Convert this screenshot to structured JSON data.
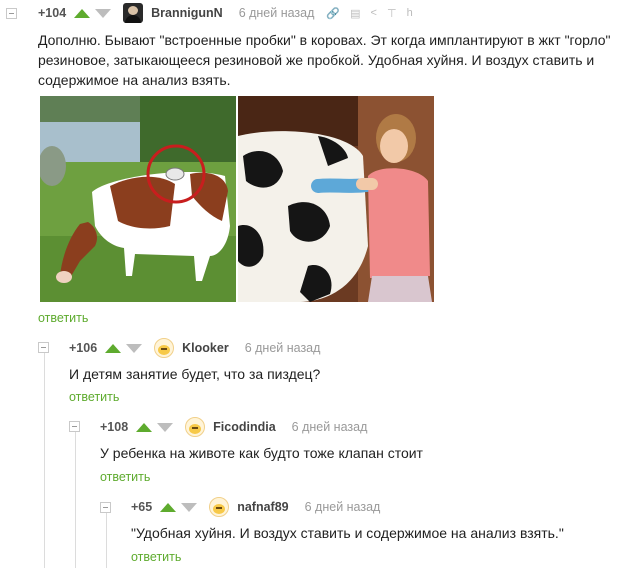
{
  "comments": [
    {
      "rating": "+104",
      "username": "BrannigunN",
      "time": "6 дней назад",
      "text_lines": [
        "Дополню. Бывают \"встроенные пробки\" в коровах. Эт когда имплантируют в жкт \"горло\"",
        "резиновое, затыкающееся резиновой же пробкой. Удобная хуйня. И воздух ставить и",
        "содержимое на анализ взять."
      ],
      "reply": "ответить",
      "icons": [
        "link-icon",
        "save-icon",
        "share-icon",
        "pin-icon",
        "more-icon"
      ]
    },
    {
      "rating": "+106",
      "username": "Klooker",
      "time": "6 дней назад",
      "text": "И детям занятие будет, что за пиздец?",
      "reply": "ответить"
    },
    {
      "rating": "+108",
      "username": "Ficodindia",
      "time": "6 дней назад",
      "text": "У ребенка на животе как будто тоже клапан стоит",
      "reply": "ответить"
    },
    {
      "rating": "+65",
      "username": "nafnaf89",
      "time": "6 дней назад",
      "text": "\"Удобная хуйня. И воздух ставить и содержимое на анализ взять.\"",
      "reply": "ответить"
    }
  ],
  "colors": {
    "accent_green": "#5eab2e",
    "vote_down": "#bdbdbd",
    "muted": "#999999"
  }
}
